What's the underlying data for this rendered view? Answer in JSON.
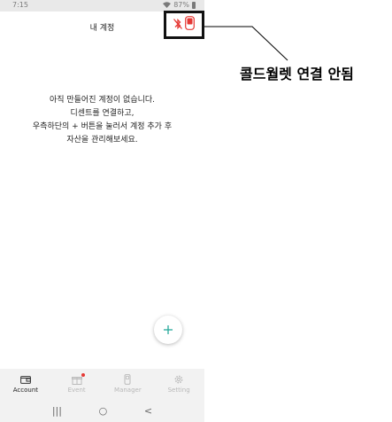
{
  "status_bar": {
    "time": "7:15",
    "battery": "87%"
  },
  "header": {
    "title": "내 계정"
  },
  "wallet_status": {
    "icon": "bluetooth-off-icon",
    "device_icon": "cold-wallet-device-icon",
    "status_color": "#e53935"
  },
  "empty_state": {
    "lines": [
      "아직 만들어진 계정이 없습니다.",
      "디센트를 연결하고,",
      "우측하단의 + 버튼을 눌러서 계정 추가 후",
      "자산을 관리해보세요."
    ]
  },
  "fab": {
    "label": "+",
    "color": "#27a99b"
  },
  "bottom_nav": {
    "items": [
      {
        "label": "Account",
        "icon": "wallet-icon",
        "active": true
      },
      {
        "label": "Event",
        "icon": "gift-icon",
        "active": false
      },
      {
        "label": "Manager",
        "icon": "manager-icon",
        "active": false
      },
      {
        "label": "Setting",
        "icon": "gear-icon",
        "active": false
      }
    ]
  },
  "system_nav": {
    "recent": "|||",
    "home": "○",
    "back": "<"
  },
  "annotation": {
    "text": "콜드월렛 연결 안됨"
  }
}
